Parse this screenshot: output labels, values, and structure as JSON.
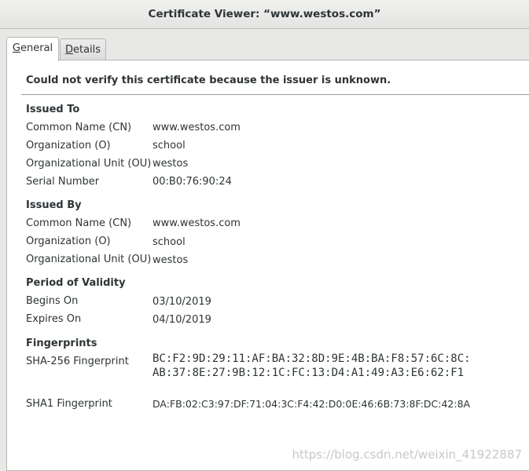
{
  "window": {
    "title": "Certificate Viewer: “www.westos.com”"
  },
  "tabs": [
    {
      "prefix": "",
      "mnemonic": "G",
      "rest": "eneral"
    },
    {
      "prefix": "",
      "mnemonic": "D",
      "rest": "etails"
    }
  ],
  "active_tab": "General",
  "warning": "Could not verify this certificate because the issuer is unknown.",
  "issued_to": {
    "heading": "Issued To",
    "cn_label": "Common Name (CN)",
    "cn": "www.westos.com",
    "o_label": "Organization (O)",
    "o": "school",
    "ou_label": "Organizational Unit (OU)",
    "ou": "westos",
    "serial_label": "Serial Number",
    "serial": "00:B0:76:90:24"
  },
  "issued_by": {
    "heading": "Issued By",
    "cn_label": "Common Name (CN)",
    "cn": "www.westos.com",
    "o_label": "Organization (O)",
    "o": "school",
    "ou_label": "Organizational Unit (OU)",
    "ou": "westos"
  },
  "validity": {
    "heading": "Period of Validity",
    "begins_label": "Begins On",
    "begins": "03/10/2019",
    "expires_label": "Expires On",
    "expires": "04/10/2019"
  },
  "fingerprints": {
    "heading": "Fingerprints",
    "sha256_label": "SHA-256 Fingerprint",
    "sha256_line1": "BC:F2:9D:29:11:AF:BA:32:8D:9E:4B:BA:F8:57:6C:8C:",
    "sha256_line2": "AB:37:8E:27:9B:12:1C:FC:13:D4:A1:49:A3:E6:62:F1",
    "sha1_label": "SHA1 Fingerprint",
    "sha1": "DA:FB:02:C3:97:DF:71:04:3C:F4:42:D0:0E:46:6B:73:8F:DC:42:8A"
  },
  "watermark": "https://blog.csdn.net/weixin_41922887"
}
